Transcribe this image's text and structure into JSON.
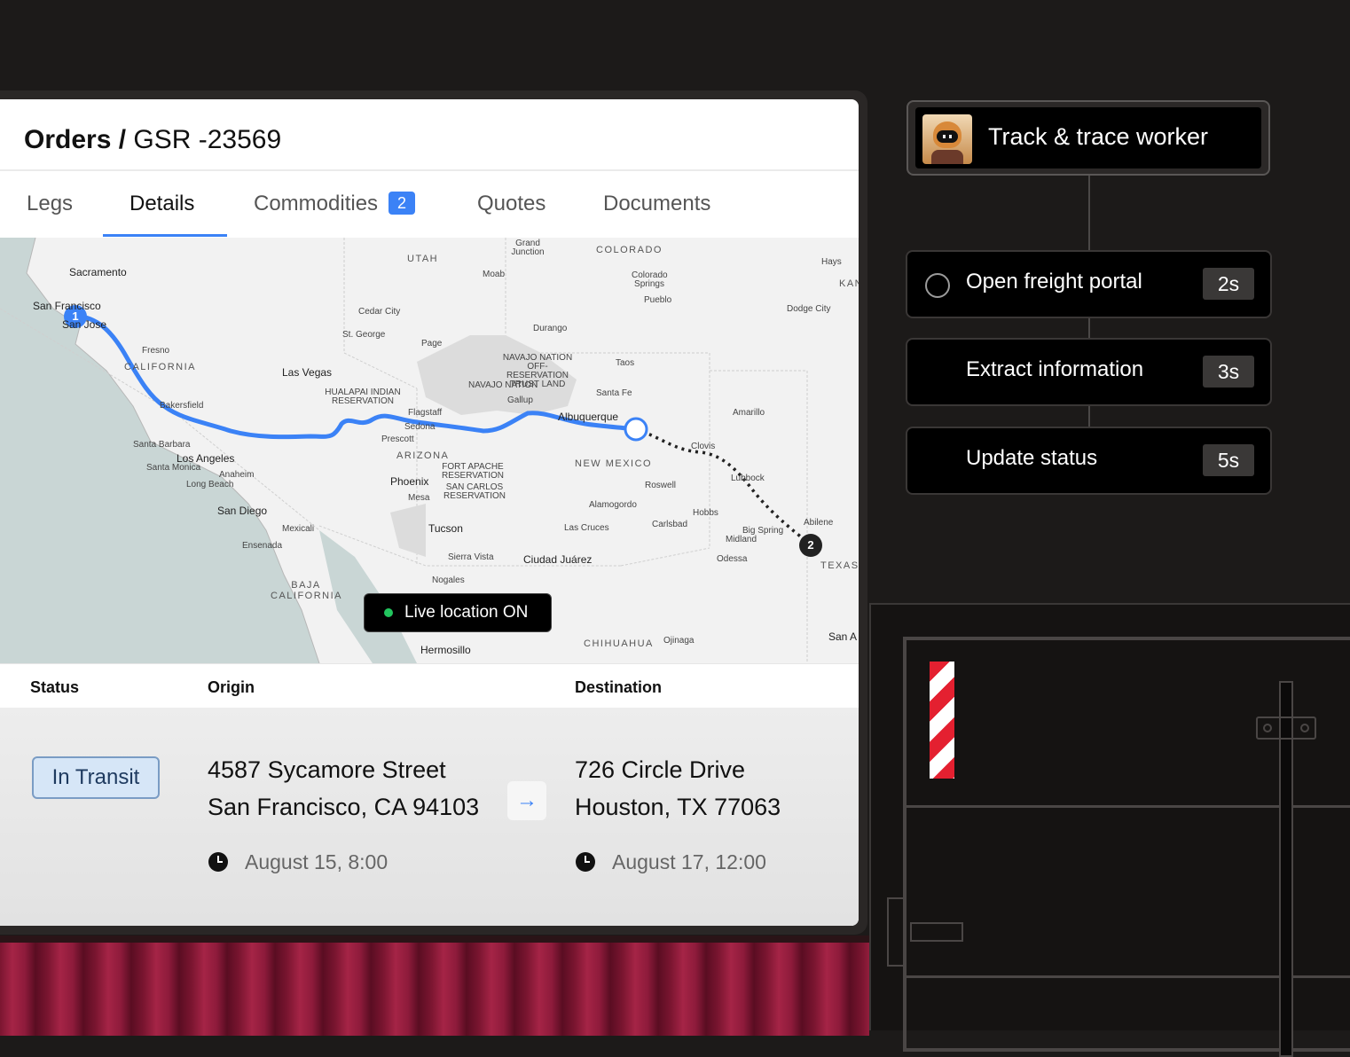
{
  "order": {
    "breadcrumb_parent": "Orders /",
    "breadcrumb_current": "GSR -23569"
  },
  "tabs": [
    {
      "label": "Legs"
    },
    {
      "label": "Details",
      "active": true
    },
    {
      "label": "Commodities",
      "badge": "2"
    },
    {
      "label": "Quotes"
    },
    {
      "label": "Documents"
    }
  ],
  "map": {
    "live_label": "Live location ON",
    "stop_markers": [
      "1",
      "2"
    ],
    "state_labels": [
      "UTAH",
      "COLORADO",
      "KAN",
      "CALIFORNIA",
      "ARIZONA",
      "NEW MEXICO",
      "TEXAS",
      "BAJA CALIFORNIA",
      "CHIHUAHUA"
    ],
    "region_labels": [
      "HUALAPAI INDIAN RESERVATION",
      "NAVAJO NATION OFF-RESERVATION TRUST LAND",
      "NAVAJO NATION",
      "FORT APACHE RESERVATION",
      "SAN CARLOS RESERVATION"
    ],
    "city_labels": [
      "Sacramento",
      "San Francisco",
      "San Jose",
      "Fresno",
      "Bakersfield",
      "Las Vegas",
      "Santa Barbara",
      "Los Angeles",
      "Santa Monica",
      "Anaheim",
      "Long Beach",
      "San Diego",
      "Mexicali",
      "Ensenada",
      "Phoenix",
      "Mesa",
      "Tucson",
      "Sierra Vista",
      "Nogales",
      "Hermosillo",
      "Flagstaff",
      "Sedona",
      "Prescott",
      "Page",
      "St. George",
      "Cedar City",
      "Moab",
      "Grand Junction",
      "Colorado Springs",
      "Pueblo",
      "Durango",
      "Gallup",
      "Albuquerque",
      "Santa Fe",
      "Taos",
      "Alamogordo",
      "Las Cruces",
      "Ciudad Juárez",
      "Roswell",
      "Carlsbad",
      "Hobbs",
      "Clovis",
      "Lubbock",
      "Amarillo",
      "Big Spring",
      "Midland",
      "Odessa",
      "Abilene",
      "Ojinaga",
      "San A",
      "Hays",
      "Dodge City"
    ]
  },
  "details": {
    "headers": {
      "status": "Status",
      "origin": "Origin",
      "destination": "Destination"
    },
    "status": "In Transit",
    "origin": {
      "line1": "4587 Sycamore Street",
      "line2": "San Francisco, CA 94103",
      "time": "August 15, 8:00"
    },
    "destination": {
      "line1": "726 Circle Drive",
      "line2": "Houston, TX 77063",
      "time": "August 17, 12:00"
    }
  },
  "workflow": {
    "worker_title": "Track & trace worker",
    "steps": [
      {
        "label": "Open freight portal",
        "duration": "2s"
      },
      {
        "label": "Extract information",
        "duration": "3s"
      },
      {
        "label": "Update status",
        "duration": "5s"
      }
    ]
  },
  "colors": {
    "accent": "#3b82f6",
    "live": "#22c55e",
    "status_bg": "#d6e6f7"
  }
}
